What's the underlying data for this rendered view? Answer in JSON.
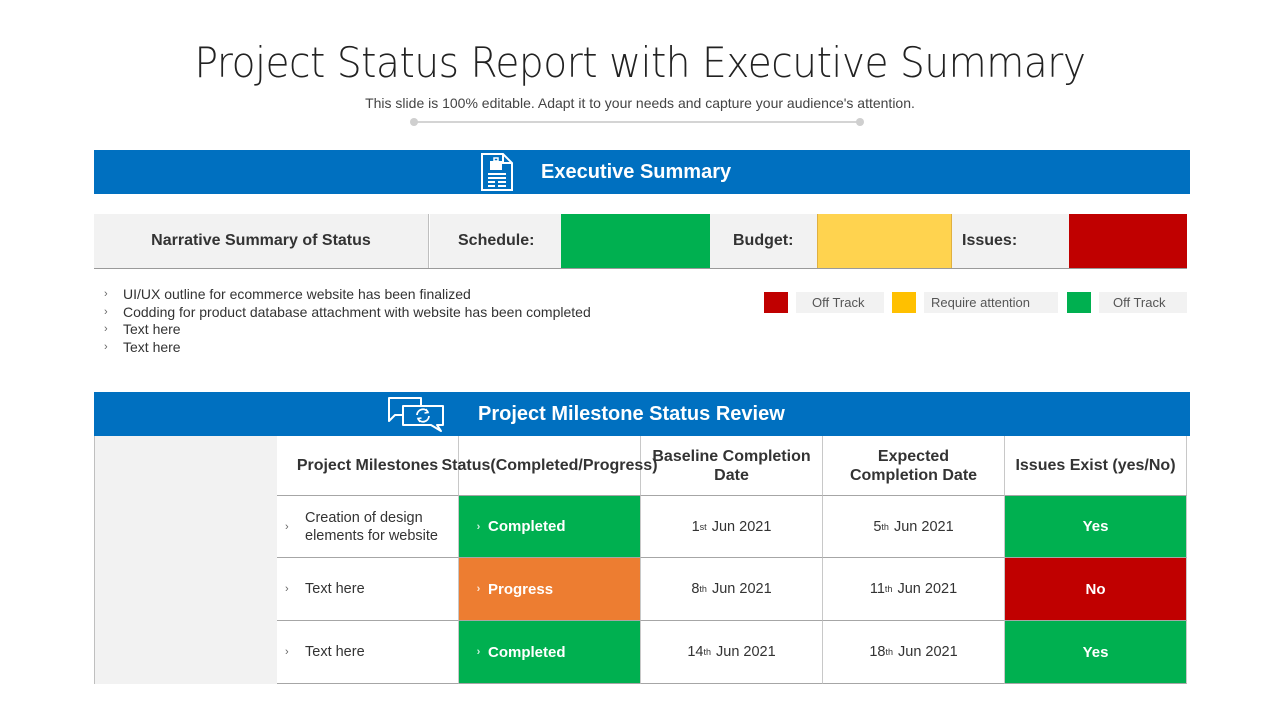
{
  "header": {
    "title": "Project Status Report with Executive Summary",
    "subtitle": "This slide is 100% editable. Adapt it to your needs and capture your audience's attention."
  },
  "colors": {
    "brand_blue": "#0070c0",
    "green": "#00b050",
    "yellow": "#ffd34f",
    "amber": "#ffc000",
    "red": "#c00000",
    "orange": "#ed7d31",
    "grey_cell": "#f2f2f2"
  },
  "executive_summary": {
    "title": "Executive Summary",
    "icon": "document-briefcase-icon",
    "narrative_label": "Narrative  Summary  of Status",
    "indicators": [
      {
        "label": "Schedule:",
        "status": "on-track",
        "color": "#00b050"
      },
      {
        "label": "Budget:",
        "status": "require-attention",
        "color": "#ffd34f"
      },
      {
        "label": "Issues:",
        "status": "off-track",
        "color": "#c00000"
      }
    ],
    "bullets": [
      "UI/UX  outline for ecommerce website has been finalized",
      "Codding for product database attachment with website has been completed",
      "Text here",
      "Text here"
    ],
    "legend": [
      {
        "label": "Off Track",
        "color": "#c00000"
      },
      {
        "label": "Require  attention",
        "color": "#ffc000"
      },
      {
        "label": "Off Track",
        "color": "#00b050"
      }
    ]
  },
  "milestones": {
    "title": "Project Milestone  Status Review",
    "icon": "chat-refresh-icon",
    "columns": [
      "Project Milestones",
      "Status(Completed/Progress)",
      "Baseline Completion Date",
      "Expected Completion Date",
      "Issues Exist (yes/No)"
    ],
    "rows": [
      {
        "milestone": "Creation of design elements for website",
        "status": "Completed",
        "status_color": "#00b050",
        "baseline_day": "1",
        "baseline_suffix": "st",
        "baseline_rest": "Jun 2021",
        "expected_day": "5",
        "expected_suffix": "th",
        "expected_rest": "Jun 2021",
        "issues": "Yes",
        "issues_color": "#00b050"
      },
      {
        "milestone": "Text here",
        "status": "Progress",
        "status_color": "#ed7d31",
        "baseline_day": "8",
        "baseline_suffix": "th",
        "baseline_rest": "Jun 2021",
        "expected_day": "11",
        "expected_suffix": "th",
        "expected_rest": "Jun 2021",
        "issues": "No",
        "issues_color": "#c00000"
      },
      {
        "milestone": "Text here",
        "status": "Completed",
        "status_color": "#00b050",
        "baseline_day": "14",
        "baseline_suffix": "th",
        "baseline_rest": "Jun 2021",
        "expected_day": "18",
        "expected_suffix": "th",
        "expected_rest": "Jun 2021",
        "issues": "Yes",
        "issues_color": "#00b050"
      }
    ]
  }
}
